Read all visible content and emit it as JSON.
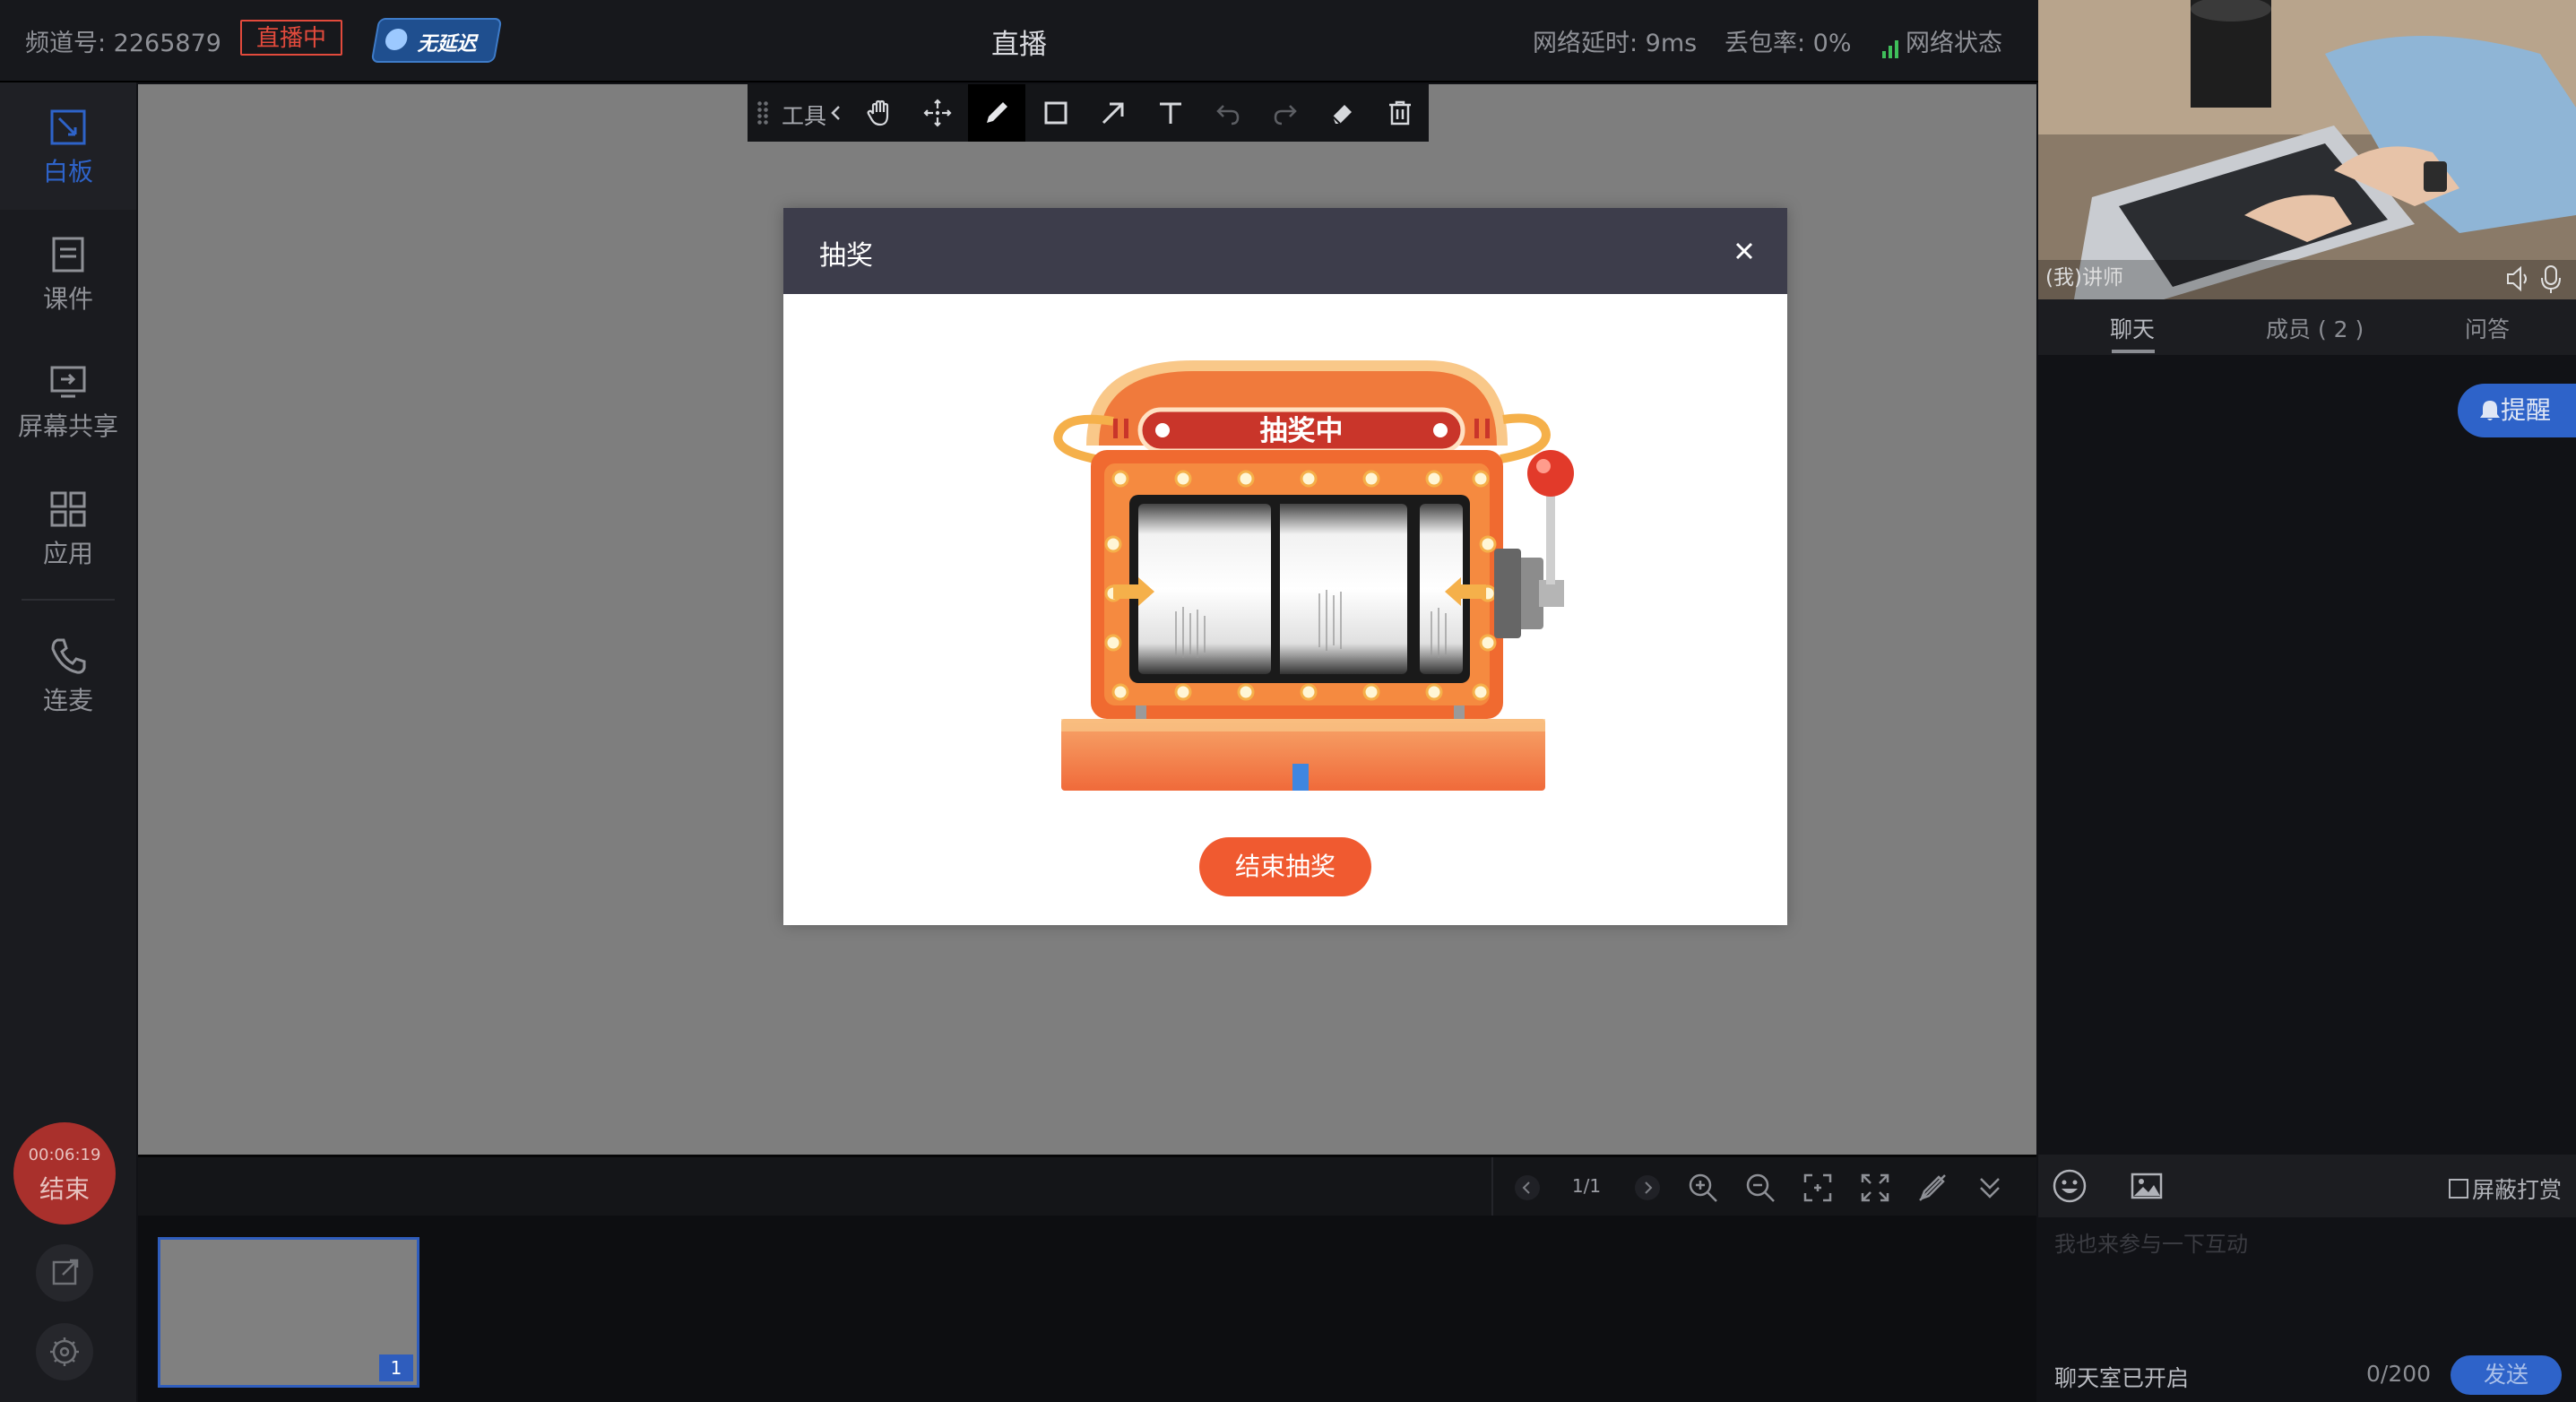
{
  "topbar": {
    "channel": "频道号: 2265879",
    "live_badge": "直播中",
    "no_lag_badge": "无延迟",
    "title": "直播",
    "latency": "网络延时: 9ms",
    "packet_loss": "丢包率: 0%",
    "network_status": "网络状态"
  },
  "sidebar": {
    "items": [
      {
        "label": "白板",
        "icon": "whiteboard-icon",
        "active": true
      },
      {
        "label": "课件",
        "icon": "courseware-icon"
      },
      {
        "label": "屏幕共享",
        "icon": "screen-share-icon"
      },
      {
        "label": "应用",
        "icon": "apps-icon"
      },
      {
        "label": "连麦",
        "icon": "phone-icon"
      }
    ],
    "end_time": "00:06:19",
    "end_label": "结束"
  },
  "toolbar": {
    "label": "工具",
    "tools": [
      "hand-icon",
      "move-icon",
      "pen-icon",
      "rectangle-icon",
      "arrow-icon",
      "text-icon",
      "undo-icon",
      "redo-icon",
      "eraser-icon",
      "delete-icon"
    ],
    "selected": "pen-icon"
  },
  "modal": {
    "title": "抽奖",
    "slot_banner": "抽奖中",
    "end_button": "结束抽奖"
  },
  "pager": {
    "page": "1/1",
    "thumb_number": "1"
  },
  "right_panel": {
    "video_label": "(我)讲师",
    "tabs": [
      "聊天",
      "成员 ( 2 )",
      "问答"
    ],
    "active_tab": 0,
    "remind_button": "提醒",
    "shield_gift": "屏蔽打赏",
    "input_placeholder": "我也来参与一下互动",
    "chat_status": "聊天室已开启",
    "char_count": "0/200",
    "send_button": "发送"
  },
  "colors": {
    "accent_blue": "#2e63c9",
    "live_red": "#e24a3c",
    "lottery_orange": "#f05a30"
  }
}
